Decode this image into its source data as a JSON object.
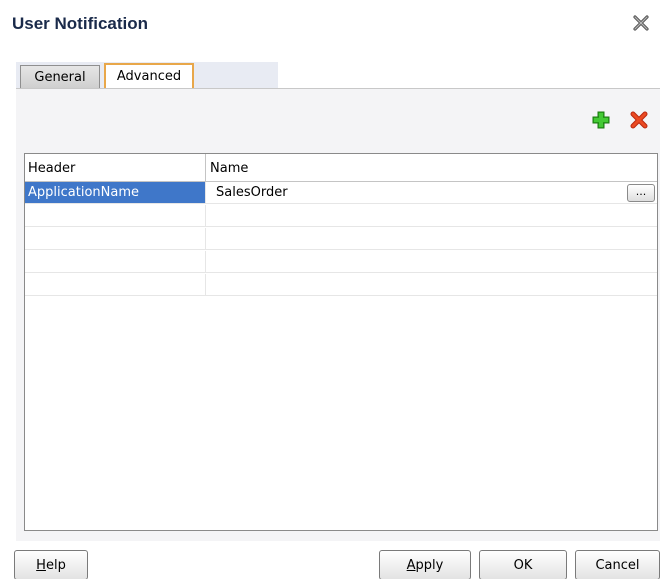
{
  "window": {
    "title": "User Notification",
    "close_icon": "close-icon"
  },
  "tabs": [
    {
      "label": "General",
      "selected": false
    },
    {
      "label": "Advanced",
      "selected": true
    }
  ],
  "toolbar": {
    "add_icon": "add-icon",
    "add_color": "#2eae1f",
    "delete_icon": "delete-icon",
    "delete_color": "#e03b1a"
  },
  "table": {
    "columns": [
      "Header",
      "Name"
    ],
    "rows": [
      {
        "header": "ApplicationName",
        "name": "SalesOrder",
        "selected": true,
        "ellipsis": "..."
      },
      {
        "header": "",
        "name": ""
      },
      {
        "header": "",
        "name": ""
      },
      {
        "header": "",
        "name": ""
      },
      {
        "header": "",
        "name": ""
      }
    ],
    "selection_color": "#3f77c9"
  },
  "buttons": {
    "help": {
      "mnemonic": "H",
      "rest": "elp"
    },
    "apply": {
      "mnemonic": "A",
      "rest": "pply"
    },
    "ok": "OK",
    "cancel": "Cancel"
  }
}
